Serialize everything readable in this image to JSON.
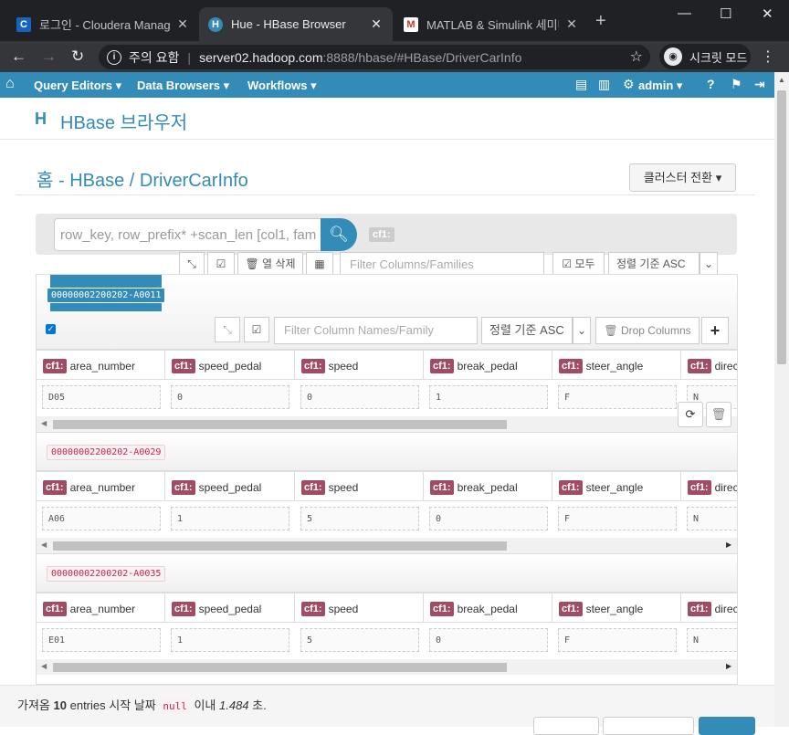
{
  "browser": {
    "tabs": [
      {
        "title": "로그인 - Cloudera Manage",
        "favicon": "C",
        "color": "#1565c0"
      },
      {
        "title": "Hue - HBase Browser",
        "favicon": "H",
        "color": "#338bb8"
      },
      {
        "title": "MATLAB & Simulink 세미나",
        "favicon": "M",
        "color": "#c0392b"
      }
    ],
    "security_label": "주의 요함",
    "url_host": "server02.hadoop.com",
    "url_path": ":8888/hbase/#HBase/DriverCarInfo",
    "incognito_label": "시크릿 모드"
  },
  "huenav": {
    "query_editors": "Query Editors ▾",
    "data_browsers": "Data Browsers ▾",
    "workflows": "Workflows ▾",
    "user": "admin ▾"
  },
  "app": {
    "title": "HBase 브라우저"
  },
  "breadcrumb": {
    "home": "홈",
    "sep1": " - ",
    "hbase": "HBase",
    "sep2": " / ",
    "table": "DriverCarInfo"
  },
  "cluster_button": "클러스터 전환 ▾",
  "search": {
    "placeholder": "row_key, row_prefix* +scan_len [col1, fam",
    "cf_badge": "cf1:"
  },
  "toolbar": {
    "delete_columns": "열 삭제",
    "filter_placeholder": "Filter Columns/Families",
    "all_label": "모두",
    "sort_label": "정렬 기준 ASC"
  },
  "row_toolbar": {
    "filter_placeholder": "Filter Column Names/Family",
    "sort_label": "정렬 기준 ASC",
    "drop_columns": "Drop Columns",
    "add": "+"
  },
  "columns": [
    {
      "cf": "cf1:",
      "name": "area_number"
    },
    {
      "cf": "cf1:",
      "name": "speed_pedal"
    },
    {
      "cf": "cf1:",
      "name": "speed"
    },
    {
      "cf": "cf1:",
      "name": "break_pedal"
    },
    {
      "cf": "cf1:",
      "name": "steer_angle"
    },
    {
      "cf": "cf1:",
      "name": "direct"
    }
  ],
  "rows": [
    {
      "key": "00000002200202-A0011",
      "values": [
        "D05",
        "0",
        "0",
        "1",
        "F",
        "N"
      ]
    },
    {
      "key": "00000002200202-A0029",
      "values": [
        "A06",
        "1",
        "5",
        "0",
        "F",
        "N"
      ]
    },
    {
      "key": "00000002200202-A0035",
      "values": [
        "E01",
        "1",
        "5",
        "0",
        "F",
        "N"
      ]
    }
  ],
  "footer": {
    "prefix": "가져옴",
    "count": "10",
    "middle": "entries 시작 날짜",
    "null_code": "null",
    "within": "이내",
    "seconds": "1.484",
    "suffix": "초."
  }
}
